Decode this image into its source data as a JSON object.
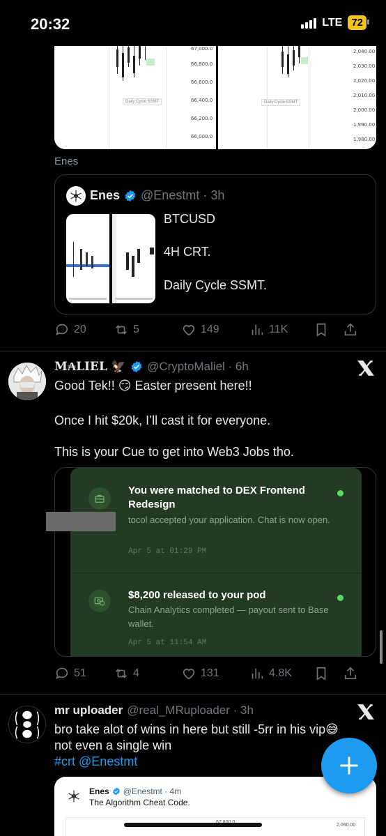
{
  "status_bar": {
    "time": "20:32",
    "network": "LTE",
    "battery": "72"
  },
  "top_media": {
    "left_ticks": [
      "67,000.0",
      "66,800.0",
      "66,600.0",
      "66,400.0",
      "66,200.0",
      "66,000.0"
    ],
    "left_label": "Daily Cycle SSMT",
    "right_ticks": [
      "2,040.00",
      "2,030.00",
      "2,020.00",
      "2,010.00",
      "2,000.00",
      "1,990.00",
      "1,980.00"
    ],
    "right_label": "Daily Cycle SSMT"
  },
  "post1": {
    "caption": "Enes",
    "quote": {
      "name": "Enes",
      "handle": "@Enestmt · 3h",
      "lines": [
        "BTCUSD",
        "4H CRT.",
        "Daily Cycle SSMT."
      ]
    },
    "actions": {
      "replies": "20",
      "reposts": "5",
      "likes": "149",
      "views": "11K"
    }
  },
  "post2": {
    "name": "M₳LIEL",
    "handle": "@CryptoMaliel · 6h",
    "text_lines": [
      "Good Tek!! 😏 Easter present here!!",
      "Once I hit $20k, I’ll cast it for everyone.",
      "This is your Cue to get into Web3 Jobs tho."
    ],
    "jobs": [
      {
        "title": "You were matched to DEX Frontend Redesign",
        "sub": "tocol accepted your application. Chat is now open.",
        "time": "Apr 5 at 01:29 PM"
      },
      {
        "title": "$8,200 released to your pod",
        "sub": "Chain Analytics completed — payout sent to Base wallet.",
        "time": "Apr 5 at 11:54 AM"
      }
    ],
    "actions": {
      "replies": "51",
      "reposts": "4",
      "likes": "131",
      "views": "4.8K"
    }
  },
  "post3": {
    "name": "mr uploader",
    "handle": "@real_MRuploader · 3h",
    "text_line1": "bro take alot of wins in here but still -5rr in his vip😅",
    "text_line2": "not even a single win",
    "hashtag": "#crt",
    "mention": "@Enestmt",
    "embed": {
      "name": "Enes",
      "handle": "@Enestmt · 4m",
      "text": "The Algorithm Cheat Code.",
      "tick_left": "67,800.0",
      "tick_right": "2,090.00"
    }
  }
}
